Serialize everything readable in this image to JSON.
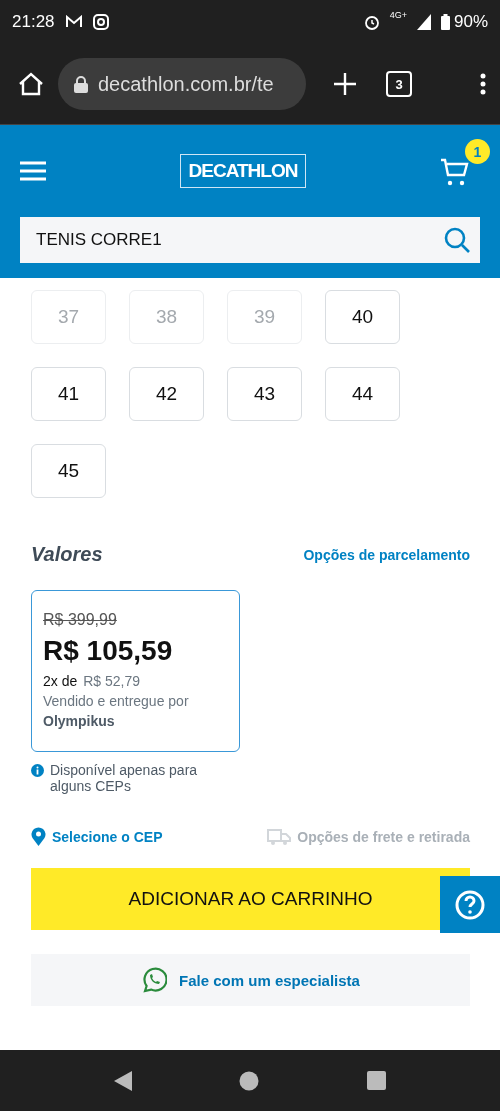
{
  "status_bar": {
    "time": "21:28",
    "network": "4G+",
    "battery": "90%"
  },
  "browser": {
    "url": "decathlon.com.br/te",
    "tab_count": "3"
  },
  "header": {
    "logo": "DECATHLON",
    "cart_count": "1",
    "search": {
      "value": "TENIS CORRE1"
    }
  },
  "sizes": [
    {
      "label": "37",
      "disabled": true,
      "selected": false
    },
    {
      "label": "38",
      "disabled": true,
      "selected": false
    },
    {
      "label": "39",
      "disabled": true,
      "selected": false
    },
    {
      "label": "40",
      "disabled": false,
      "selected": false
    },
    {
      "label": "41",
      "disabled": false,
      "selected": false
    },
    {
      "label": "42",
      "disabled": false,
      "selected": false
    },
    {
      "label": "43",
      "disabled": false,
      "selected": false
    },
    {
      "label": "44",
      "disabled": false,
      "selected": false
    },
    {
      "label": "45",
      "disabled": false,
      "selected": false
    }
  ],
  "values": {
    "title": "Valores",
    "installments_link": "Opções de parcelamento",
    "offer": {
      "old_price": "R$ 399,99",
      "price": "R$ 105,59",
      "installment_prefix": "2x de",
      "installment_value": "R$ 52,79",
      "seller_text": "Vendido e entregue por",
      "seller": "Olympikus"
    },
    "notice": "Disponível apenas para alguns CEPs"
  },
  "delivery": {
    "cep_link": "Selecione o CEP",
    "shipping_options": {
      "label": "Opções de frete e retirada",
      "disabled": true
    }
  },
  "add_to_cart": "ADICIONAR AO CARRINHO",
  "specialist": "Fale com um especialista"
}
